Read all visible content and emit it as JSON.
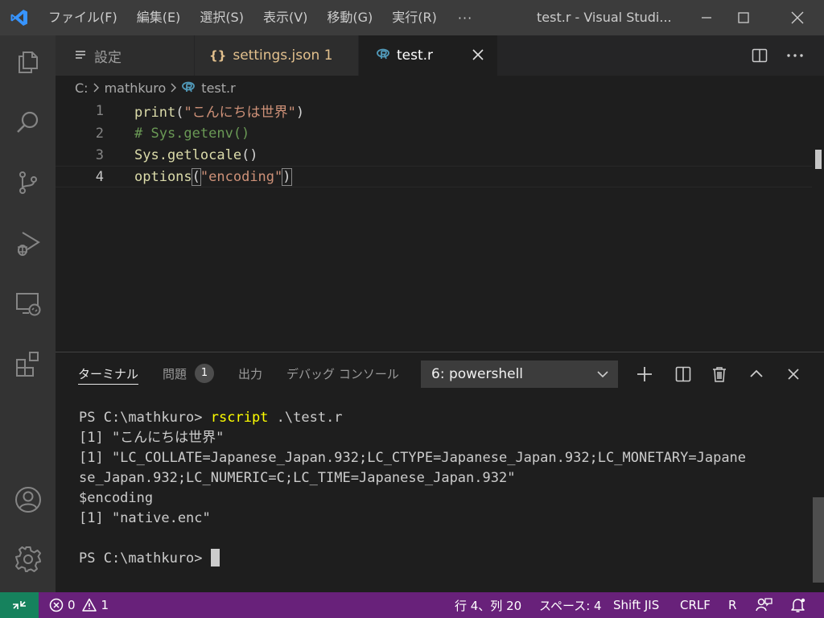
{
  "titlebar": {
    "menu": [
      "ファイル(F)",
      "編集(E)",
      "選択(S)",
      "表示(V)",
      "移動(G)",
      "実行(R)"
    ],
    "more": "···",
    "title": "test.r - Visual Studi..."
  },
  "tabs": [
    {
      "label": "設定",
      "icon": "list-icon"
    },
    {
      "label": "settings.json 1",
      "icon": "braces-icon",
      "color": "#e2c08d"
    },
    {
      "label": "test.r",
      "icon": "r-file-icon"
    }
  ],
  "breadcrumb": [
    "C:",
    "mathkuro",
    "test.r"
  ],
  "editor": {
    "lines": [
      {
        "num": "1",
        "tokens": [
          {
            "t": "print",
            "c": "fn"
          },
          {
            "t": "(",
            "c": "pn"
          },
          {
            "t": "\"こんにちは世界\"",
            "c": "str"
          },
          {
            "t": ")",
            "c": "pn"
          }
        ]
      },
      {
        "num": "2",
        "tokens": [
          {
            "t": "# Sys.getenv()",
            "c": "cm"
          }
        ]
      },
      {
        "num": "3",
        "tokens": [
          {
            "t": "Sys.getlocale",
            "c": "fn"
          },
          {
            "t": "()",
            "c": "pn"
          }
        ]
      },
      {
        "num": "4",
        "tokens": [
          {
            "t": "options",
            "c": "fn"
          },
          {
            "t": "(",
            "c": "pn"
          },
          {
            "t": "\"encoding\"",
            "c": "str"
          },
          {
            "t": ")",
            "c": "pn"
          }
        ]
      }
    ]
  },
  "panel": {
    "tabs": {
      "terminal": "ターミナル",
      "problems": "問題",
      "problems_count": "1",
      "output": "出力",
      "debug_console": "デバッグ コンソール"
    },
    "terminal_select": "6: powershell",
    "terminal_lines": {
      "l1_prompt": "PS C:\\mathkuro> ",
      "l1_cmd": "rscript",
      "l1_arg": " .\\test.r",
      "l2": "[1] \"こんにちは世界\"",
      "l3": "[1] \"LC_COLLATE=Japanese_Japan.932;LC_CTYPE=Japanese_Japan.932;LC_MONETARY=Japane",
      "l4": "se_Japan.932;LC_NUMERIC=C;LC_TIME=Japanese_Japan.932\"",
      "l5": "$encoding",
      "l6": "[1] \"native.enc\"",
      "l7": "",
      "l8_prompt": "PS C:\\mathkuro> "
    }
  },
  "statusbar": {
    "errors": "0",
    "warnings": "1",
    "position": "行 4、列 20",
    "spaces": "スペース: 4",
    "encoding": "Shift JIS",
    "eol": "CRLF",
    "language": "R"
  },
  "colors": {
    "accent": "#68217a",
    "remote": "#16825d",
    "vscode_blue": "#3794ff"
  }
}
